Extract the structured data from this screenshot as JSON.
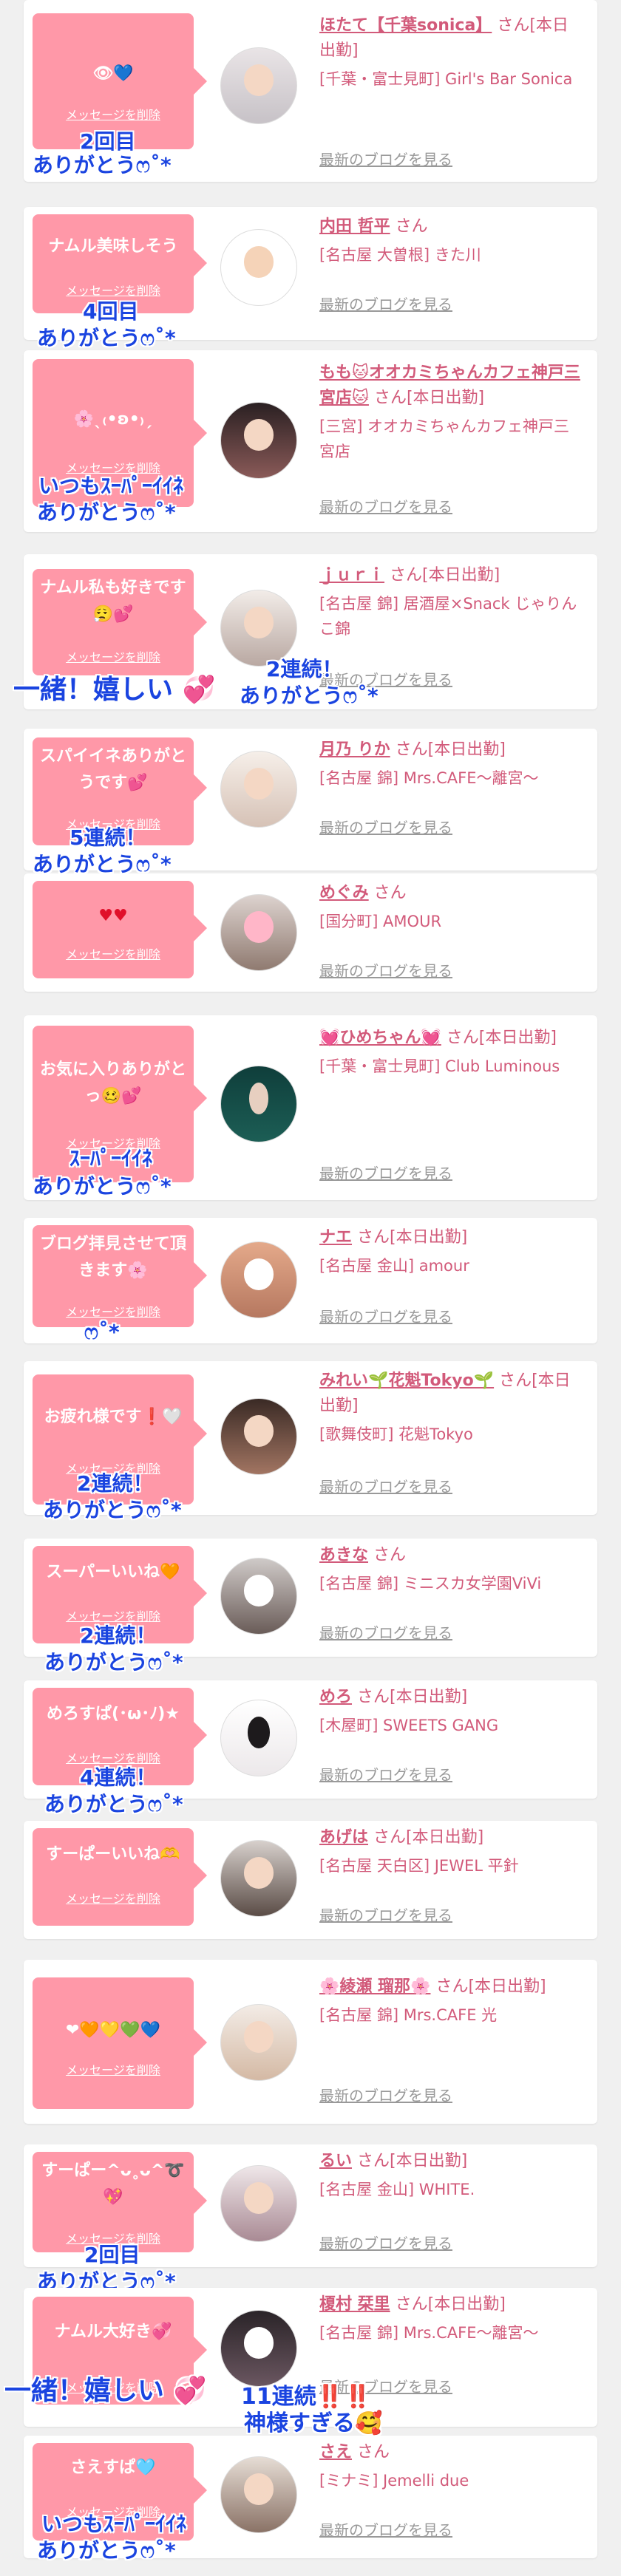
{
  "delete_label": "メッセージを削除",
  "blog_label": "最新のブログを見る",
  "colors": {
    "bubble": "#ff98a8",
    "name": "#d25a7a",
    "annotation": "#1a44e0"
  },
  "items": [
    {
      "message": "👁💙",
      "name": "ほたて【千葉sonica】",
      "suffix": "さん[本日出勤]",
      "shop": "[千葉・富士見町] Girl's Bar Sonica",
      "notes": [
        "2回目",
        "ありがとうෆ˚*"
      ]
    },
    {
      "message": "ナムル美味しそう",
      "name": "内田 哲平",
      "suffix": "さん",
      "shop": "[名古屋 大曽根] きた川",
      "notes": [
        "4回目",
        "ありがとうෆ˚*"
      ]
    },
    {
      "message": "🌸ˎ₍•ʚ•₎ˏ",
      "name": "もも🐱オオカミちゃんカフェ神戸三宮店🐱",
      "suffix": "さん[本日出勤]",
      "shop": "[三宮] オオカミちゃんカフェ神戸三宮店",
      "notes": [
        "いつもｽｰﾊﾟｰｲｲﾈ",
        "ありがとうෆ˚*"
      ]
    },
    {
      "message": "ナムル私も好きです😮‍💨💕",
      "name": "ｊｕｒｉ",
      "suffix": "さん[本日出勤]",
      "shop": "[名古屋 錦] 居酒屋×Snack じゃりんこ錦",
      "notes": [
        "一緒！嬉しい 💞",
        "2連続！",
        "ありがとうෆ˚*"
      ]
    },
    {
      "message": "スパイイネありがとうです💕",
      "name": "月乃 りか",
      "suffix": "さん[本日出勤]",
      "shop": "[名古屋 錦] Mrs.CAFE〜離宮〜",
      "notes": [
        "5連続！",
        "ありがとうෆ˚*"
      ]
    },
    {
      "message": "♥♥",
      "name": "めぐみ",
      "suffix": "さん",
      "shop": "[国分町] AMOUR",
      "notes": []
    },
    {
      "message": "お気に入りありがとっ🥴💕",
      "name": "💓ひめちゃん💓",
      "suffix": "さん[本日出勤]",
      "shop": "[千葉・富士見町] Club Luminous",
      "notes": [
        "ｽｰﾊﾟｰｲｲﾈ",
        "ありがとうෆ˚*"
      ]
    },
    {
      "message": "ブログ拝見させて頂きます🌸",
      "name": "ナエ",
      "suffix": "さん[本日出勤]",
      "shop": "[名古屋 金山] amour",
      "notes": [
        "ෆ˚*"
      ]
    },
    {
      "message": "お疲れ様です❗🤍",
      "name": "みれい🌱花魁Tokyo🌱",
      "suffix": "さん[本日出勤]",
      "shop": "[歌舞伎町] 花魁Tokyo",
      "notes": [
        "2連続！",
        "ありがとうෆ˚*"
      ]
    },
    {
      "message": "スーパーいいね🧡",
      "name": "あきな",
      "suffix": "さん",
      "shop": "[名古屋 錦] ミニスカ女学園ViVi",
      "notes": [
        "2連続！",
        "ありがとうෆ˚*"
      ]
    },
    {
      "message": "めろすぱ(･ω･ﾉ)★",
      "name": "めろ",
      "suffix": "さん[本日出勤]",
      "shop": "[木屋町] SWEETS GANG",
      "notes": [
        "4連続！",
        "ありがとうෆ˚*"
      ]
    },
    {
      "message": "すーぱーいいね🫶",
      "name": "あげは",
      "suffix": "さん[本日出勤]",
      "shop": "[名古屋 天白区] JEWEL 平針",
      "notes": []
    },
    {
      "message": "❤🧡💛💚💙",
      "name": "🌸綾瀬 瑠那🌸",
      "suffix": "さん[本日出勤]",
      "shop": "[名古屋 錦] Mrs.CAFE 光",
      "notes": []
    },
    {
      "message": "すーぱー^ᴗ˳ᴗ^➰💖",
      "name": "るい",
      "suffix": "さん[本日出勤]",
      "shop": "[名古屋 金山] WHITE.",
      "notes": [
        "2回目",
        "ありがとうෆ˚*"
      ]
    },
    {
      "message": "ナムル大好き💞",
      "name": "榎村 栞里",
      "suffix": "さん[本日出勤]",
      "shop": "[名古屋 錦] Mrs.CAFE〜離宮〜",
      "notes": [
        "一緒！嬉しい 💞",
        "11連続‼️‼️",
        "神様すぎる🥰"
      ]
    },
    {
      "message": "さえすぱ🩵",
      "name": "さえ",
      "suffix": "さん",
      "shop": "[ミナミ] Jemelli due",
      "notes": [
        "いつもｽｰﾊﾟｰｲｲﾈ",
        "ありがとうෆ˚*"
      ]
    }
  ]
}
